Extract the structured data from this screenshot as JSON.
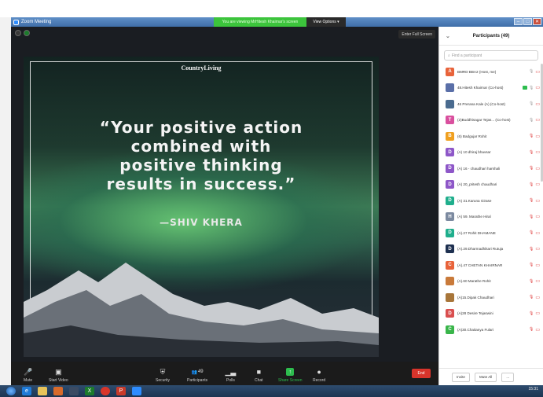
{
  "window": {
    "title": "Zoom Meeting",
    "view_banner": "You are viewing MrHitesh Khairnar's screen",
    "view_options": "View Options ▾",
    "controls": [
      "–",
      "□",
      "✕"
    ]
  },
  "video": {
    "fullscreen_label": "Enter Full Screen",
    "poster_brand": "CountryLiving",
    "quote_line1": "“Your positive action",
    "quote_line2": "combined with",
    "quote_line3": "positive thinking",
    "quote_line4": "results in success.”",
    "author": "—SHIV KHERA"
  },
  "toolbar": {
    "mute": "Mute",
    "start_video": "Start Video",
    "security": "Security",
    "participants": "Participants",
    "participants_count": "49",
    "polls": "Polls",
    "chat": "Chat",
    "share_screen": "Share Screen",
    "record": "Record",
    "end": "End"
  },
  "panel": {
    "title": "Participants (49)",
    "search_placeholder": "Find a participant",
    "participants": [
      {
        "initial": "A",
        "color": "#e8633a",
        "name": "BMRD BBA2 (Host, me)",
        "mic_muted": false,
        "video_off": true,
        "sharing": false
      },
      {
        "initial": "",
        "color": "#5a6fa8",
        "name": "48.Hitesh Khairnar (Co-host)",
        "mic_muted": false,
        "video_off": true,
        "sharing": true
      },
      {
        "initial": "",
        "color": "#4a6b8f",
        "name": "46 Prerana Kale (A) (Co-host)",
        "mic_muted": false,
        "video_off": true,
        "sharing": false
      },
      {
        "initial": "T",
        "color": "#d94f9e",
        "name": "(2)Buddhisagar Tejas... (Co-host)",
        "mic_muted": false,
        "video_off": true,
        "sharing": false
      },
      {
        "initial": "B",
        "color": "#f0a020",
        "name": "(6) Badgujar Rohit",
        "mic_muted": true,
        "video_off": true,
        "sharing": false
      },
      {
        "initial": "D",
        "color": "#8e57c8",
        "name": "(A) 10 dhiraj bhavsar",
        "mic_muted": true,
        "video_off": true,
        "sharing": false
      },
      {
        "initial": "D",
        "color": "#8e57c8",
        "name": "(A) 16 - chaudhari harshali",
        "mic_muted": true,
        "video_off": true,
        "sharing": false
      },
      {
        "initial": "D",
        "color": "#8e57c8",
        "name": "(A) 20_pritesh chaudhari",
        "mic_muted": true,
        "video_off": true,
        "sharing": false
      },
      {
        "initial": "D",
        "color": "#1fae8c",
        "name": "(A) 31.Karuna Girase",
        "mic_muted": true,
        "video_off": true,
        "sharing": false
      },
      {
        "initial": "H",
        "color": "#7c8aa0",
        "name": "(A) 59. Marathe Hiral",
        "mic_muted": true,
        "video_off": true,
        "sharing": false
      },
      {
        "initial": "D",
        "color": "#1fae8c",
        "name": "(A).27 Rohit DHAMANE",
        "mic_muted": true,
        "video_off": true,
        "sharing": false
      },
      {
        "initial": "D",
        "color": "#1e3050",
        "name": "(A).29.Dharmadhikari Rutuja",
        "mic_muted": true,
        "video_off": true,
        "sharing": false
      },
      {
        "initial": "C",
        "color": "#e8633a",
        "name": "(A).47 CHETAN KHAIRNAR",
        "mic_muted": true,
        "video_off": true,
        "sharing": false
      },
      {
        "initial": "",
        "color": "#c97a3a",
        "name": "(A).60 Marathe Rohit",
        "mic_muted": true,
        "video_off": true,
        "sharing": false
      },
      {
        "initial": "",
        "color": "#a8763a",
        "name": "(A)15.Dipak Chaudhari",
        "mic_muted": true,
        "video_off": true,
        "sharing": false
      },
      {
        "initial": "D",
        "color": "#d94f4f",
        "name": "(A)28 Desire Tejaswini",
        "mic_muted": true,
        "video_off": true,
        "sharing": false
      },
      {
        "initial": "C",
        "color": "#39b54a",
        "name": "(A)30.Chaitanya Fulari",
        "mic_muted": true,
        "video_off": true,
        "sharing": false
      }
    ],
    "invite": "Invite",
    "mute_all": "Mute All",
    "more": "..."
  },
  "taskbar": {
    "clock": "15:31"
  }
}
